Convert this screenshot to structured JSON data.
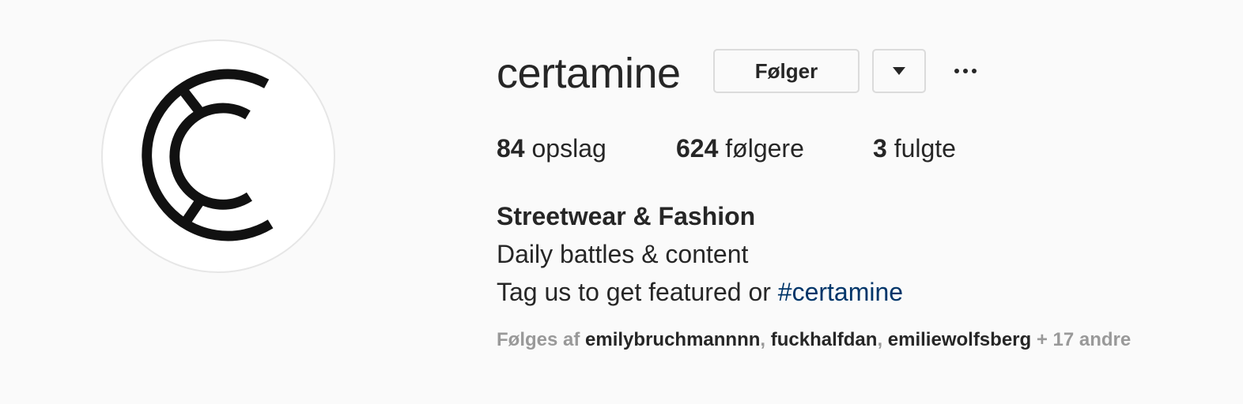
{
  "profile": {
    "username": "certamine",
    "avatar_icon": "certamine-logo-icon"
  },
  "actions": {
    "follow_label": "Følger",
    "dropdown_icon": "caret-down-icon",
    "more_icon": "more-options-icon"
  },
  "stats": {
    "posts_count": "84",
    "posts_label": "opslag",
    "followers_count": "624",
    "followers_label": "følgere",
    "following_count": "3",
    "following_label": "fulgte"
  },
  "bio": {
    "name": "Streetwear & Fashion",
    "line1": "Daily battles & content",
    "line2_text": "Tag us to get featured or ",
    "hashtag": "#certamine"
  },
  "followed_by": {
    "prefix": "Følges af",
    "users": [
      "emilybruchmannnn",
      "fuckhalfdan",
      "emiliewolfsberg"
    ],
    "separator": ",",
    "others": "+ 17 andre"
  },
  "colors": {
    "background": "#fafafa",
    "text": "#262626",
    "hashtag": "#003569",
    "muted": "#999999",
    "border": "#dbdbdb"
  }
}
